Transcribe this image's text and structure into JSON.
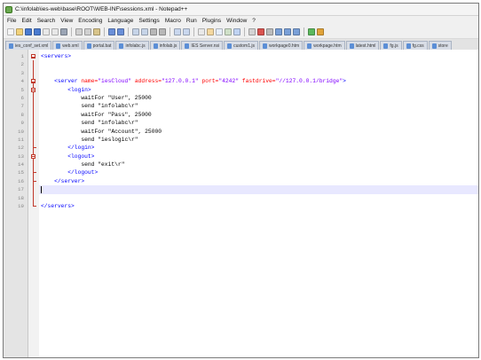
{
  "window": {
    "title": "C:\\infolab\\ies-web\\base\\ROOT\\WEB-INF\\sessions.xml - Notepad++"
  },
  "menu": [
    "File",
    "Edit",
    "Search",
    "View",
    "Encoding",
    "Language",
    "Settings",
    "Macro",
    "Run",
    "Plugins",
    "Window",
    "?"
  ],
  "toolbar": {
    "icons": [
      "new-file-icon",
      "open-file-icon",
      "save-icon",
      "save-all-icon",
      "close-icon",
      "close-all-icon",
      "print-icon",
      "cut-icon",
      "copy-icon",
      "paste-icon",
      "undo-icon",
      "redo-icon",
      "find-icon",
      "replace-icon",
      "zoom-in-icon",
      "zoom-out-icon",
      "sync-v-icon",
      "sync-h-icon",
      "word-wrap-icon",
      "all-chars-icon",
      "indent-guide-icon",
      "udl-icon",
      "doc-map-icon",
      "function-list-icon",
      "record-macro-icon",
      "stop-macro-icon",
      "play-macro-icon",
      "run-macro-icon",
      "save-macro-icon",
      "spell-check-icon",
      "settings-icon"
    ],
    "accent": "#3a78c4"
  },
  "tabs": [
    "ies_conf_set.xml",
    "web.xml",
    "portal.bat",
    "infolabc.js",
    "infolab.js",
    "IES Server.nsi",
    "custom1.js",
    "workpage0.htm",
    "workpage.htm",
    "latest.html",
    "fg.js",
    "fg.css",
    "store"
  ],
  "editor": {
    "line_numbers": [
      "1",
      "2",
      "3",
      "4",
      "5",
      "6",
      "7",
      "8",
      "9",
      "10",
      "11",
      "12",
      "13",
      "14",
      "15",
      "16",
      "17",
      "18",
      "19"
    ],
    "active_line": 17,
    "lines": [
      {
        "t": [
          {
            "c": "tag",
            "v": "<servers>"
          }
        ]
      },
      {
        "t": []
      },
      {
        "t": []
      },
      {
        "t": [
          {
            "c": "txt",
            "v": "    "
          },
          {
            "c": "tag",
            "v": "<server "
          },
          {
            "c": "attr",
            "v": "name="
          },
          {
            "c": "val",
            "v": "\"iesCloud\" "
          },
          {
            "c": "attr",
            "v": "address="
          },
          {
            "c": "val",
            "v": "\"127.0.0.1\" "
          },
          {
            "c": "attr",
            "v": "port="
          },
          {
            "c": "val",
            "v": "\"4242\" "
          },
          {
            "c": "attr",
            "v": "fastdrive="
          },
          {
            "c": "val",
            "v": "\"//127.0.0.1/bridge\""
          },
          {
            "c": "tag",
            "v": ">"
          }
        ]
      },
      {
        "t": [
          {
            "c": "txt",
            "v": "        "
          },
          {
            "c": "tag",
            "v": "<login>"
          }
        ]
      },
      {
        "t": [
          {
            "c": "txt",
            "v": "            waitFor \"User\", 25000"
          }
        ]
      },
      {
        "t": [
          {
            "c": "txt",
            "v": "            send \"infolabc\\r\""
          }
        ]
      },
      {
        "t": [
          {
            "c": "txt",
            "v": "            waitFor \"Pass\", 25000"
          }
        ]
      },
      {
        "t": [
          {
            "c": "txt",
            "v": "            send \"infolabc\\r\""
          }
        ]
      },
      {
        "t": [
          {
            "c": "txt",
            "v": "            waitFor \"Account\", 25000"
          }
        ]
      },
      {
        "t": [
          {
            "c": "txt",
            "v": "            send \"ieslogic\\r\""
          }
        ]
      },
      {
        "t": [
          {
            "c": "txt",
            "v": "        "
          },
          {
            "c": "tag",
            "v": "</login>"
          }
        ]
      },
      {
        "t": [
          {
            "c": "txt",
            "v": "        "
          },
          {
            "c": "tag",
            "v": "<logout>"
          }
        ]
      },
      {
        "t": [
          {
            "c": "txt",
            "v": "            send \"exit\\r\""
          }
        ]
      },
      {
        "t": [
          {
            "c": "txt",
            "v": "        "
          },
          {
            "c": "tag",
            "v": "</logout>"
          }
        ]
      },
      {
        "t": [
          {
            "c": "txt",
            "v": "    "
          },
          {
            "c": "tag",
            "v": "</server>"
          }
        ]
      },
      {
        "t": []
      },
      {
        "t": []
      },
      {
        "t": [
          {
            "c": "tag",
            "v": "</servers>"
          }
        ]
      }
    ]
  }
}
